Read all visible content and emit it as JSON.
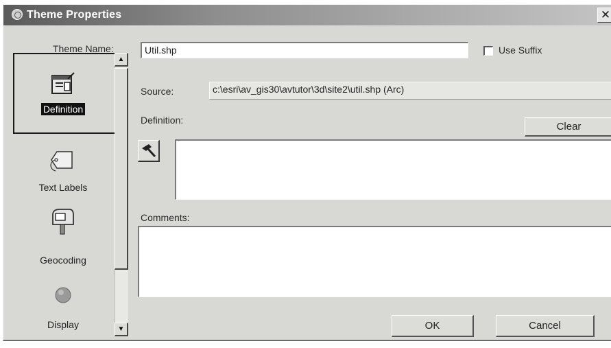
{
  "window": {
    "title": "Theme Properties",
    "close_glyph": "✕",
    "app_icon": "app-icon"
  },
  "theme_name": {
    "label": "Theme Name:",
    "value": "Util.shp"
  },
  "use_suffix": {
    "label": "Use Suffix",
    "checked": false
  },
  "sidebar": {
    "items": [
      {
        "label": "Definition",
        "icon": "definition-icon",
        "selected": true
      },
      {
        "label": "Text Labels",
        "icon": "tag-icon",
        "selected": false
      },
      {
        "label": "Geocoding",
        "icon": "mailbox-icon",
        "selected": false
      },
      {
        "label": "Display",
        "icon": "display-circle-icon",
        "selected": false
      }
    ],
    "scroll_up": "▲",
    "scroll_down": "▼"
  },
  "source": {
    "label": "Source:",
    "value": "c:\\esri\\av_gis30\\avtutor\\3d\\site2\\util.shp (Arc)"
  },
  "definition": {
    "label": "Definition:",
    "value": "",
    "clear_label": "Clear",
    "query_icon": "hammer-icon"
  },
  "comments": {
    "label": "Comments:",
    "value": ""
  },
  "footer": {
    "ok_label": "OK",
    "cancel_label": "Cancel"
  }
}
